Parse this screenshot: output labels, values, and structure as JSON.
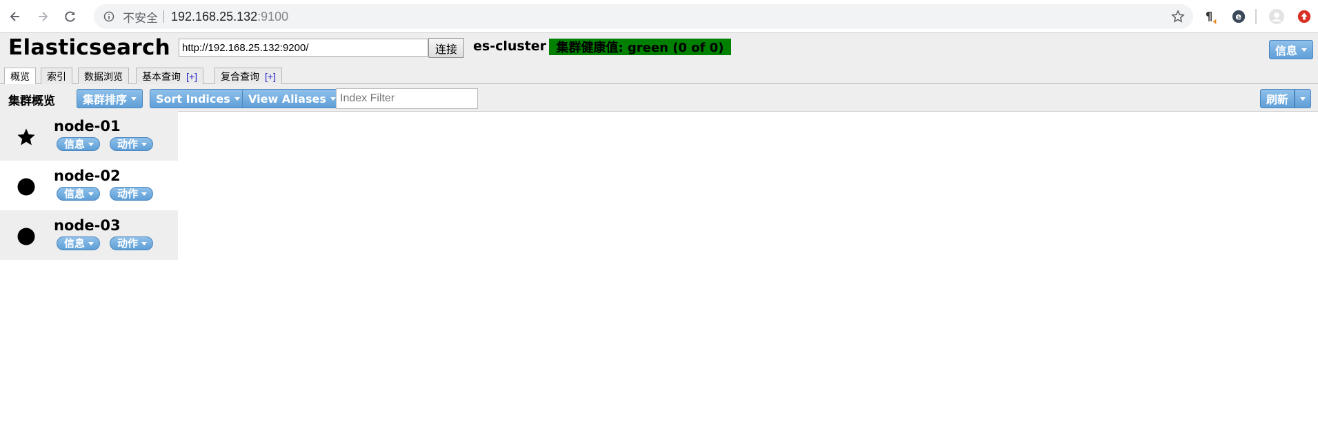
{
  "browser": {
    "insecure_label": "不安全",
    "url_host": "192.168.25.132",
    "url_port": ":9100"
  },
  "header": {
    "title": "Elasticsearch",
    "connect_url": "http://192.168.25.132:9200/",
    "connect_label": "连接",
    "cluster_name": "es-cluster",
    "health": "集群健康值: green (0 of 0)",
    "health_color": "#008000",
    "info_label": "信息"
  },
  "tabs": [
    {
      "label": "概览",
      "plus": ""
    },
    {
      "label": "索引",
      "plus": ""
    },
    {
      "label": "数据浏览",
      "plus": ""
    },
    {
      "label": "基本查询",
      "plus": "[+]"
    },
    {
      "label": "复合查询",
      "plus": "[+]"
    }
  ],
  "toolbar": {
    "title": "集群概览",
    "sort_cluster_label": "集群排序",
    "sort_indices_label": "Sort Indices",
    "view_aliases_label": "View Aliases",
    "index_filter_placeholder": "Index Filter",
    "refresh_label": "刷新"
  },
  "nodes": [
    {
      "name": "node-01",
      "icon": "star-icon",
      "info_label": "信息",
      "action_label": "动作"
    },
    {
      "name": "node-02",
      "icon": "circle-icon",
      "info_label": "信息",
      "action_label": "动作"
    },
    {
      "name": "node-03",
      "icon": "circle-icon",
      "info_label": "信息",
      "action_label": "动作"
    }
  ],
  "colors": {
    "button_blue": "#5f9fd8",
    "panel_gray": "#eeeeee"
  }
}
